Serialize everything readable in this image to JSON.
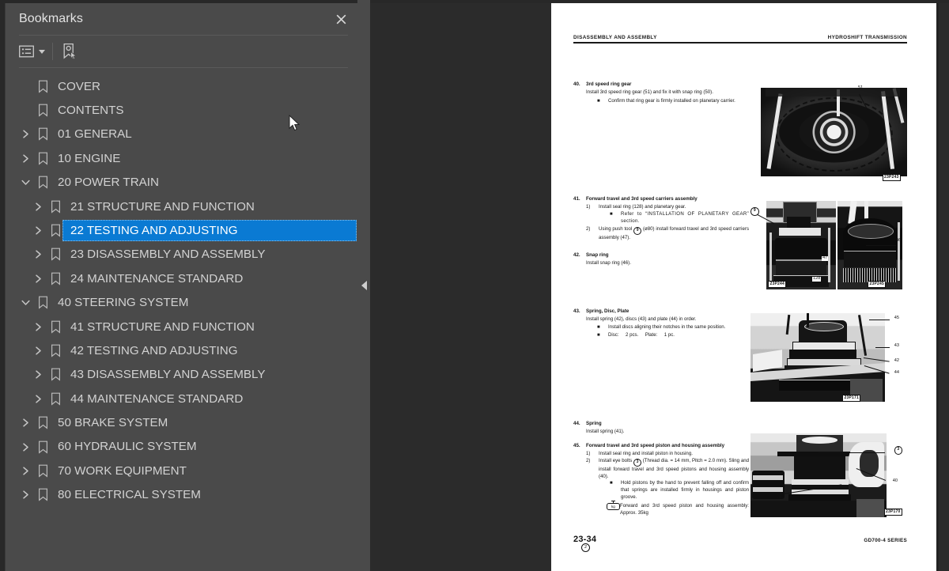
{
  "panel": {
    "title": "Bookmarks",
    "close_icon": "close-icon",
    "toolbar": {
      "options_label": "bookmark-options",
      "options_icon": "list-options-icon",
      "new_bookmark_icon": "new-bookmark-icon"
    },
    "collapse_icon": "collapse-left-icon",
    "selected_id": "22",
    "selection_color": "#0a7ad3",
    "items": [
      {
        "label": "COVER",
        "level": 0,
        "twisty": "none",
        "selected": false
      },
      {
        "label": "CONTENTS",
        "level": 0,
        "twisty": "none",
        "selected": false
      },
      {
        "label": "01 GENERAL",
        "level": 0,
        "twisty": "collapsed",
        "selected": false
      },
      {
        "label": "10 ENGINE",
        "level": 0,
        "twisty": "collapsed",
        "selected": false
      },
      {
        "label": "20 POWER TRAIN",
        "level": 0,
        "twisty": "expanded",
        "selected": false
      },
      {
        "label": "21 STRUCTURE AND FUNCTION",
        "level": 1,
        "twisty": "collapsed",
        "selected": false
      },
      {
        "label": "22 TESTING AND ADJUSTING",
        "level": 1,
        "twisty": "collapsed",
        "selected": true
      },
      {
        "label": "23 DISASSEMBLY AND ASSEMBLY",
        "level": 1,
        "twisty": "collapsed",
        "selected": false
      },
      {
        "label": "24 MAINTENANCE STANDARD",
        "level": 1,
        "twisty": "collapsed",
        "selected": false
      },
      {
        "label": "40 STEERING SYSTEM",
        "level": 0,
        "twisty": "expanded",
        "selected": false
      },
      {
        "label": "41 STRUCTURE AND FUNCTION",
        "level": 1,
        "twisty": "collapsed",
        "selected": false
      },
      {
        "label": "42 TESTING AND ADJUSTING",
        "level": 1,
        "twisty": "collapsed",
        "selected": false
      },
      {
        "label": "43 DISASSEMBLY AND ASSEMBLY",
        "level": 1,
        "twisty": "collapsed",
        "selected": false
      },
      {
        "label": "44 MAINTENANCE STANDARD",
        "level": 1,
        "twisty": "collapsed",
        "selected": false
      },
      {
        "label": "50 BRAKE SYSTEM",
        "level": 0,
        "twisty": "collapsed",
        "selected": false
      },
      {
        "label": "60 HYDRAULIC SYSTEM",
        "level": 0,
        "twisty": "collapsed",
        "selected": false
      },
      {
        "label": "70 WORK EQUIPMENT",
        "level": 0,
        "twisty": "collapsed",
        "selected": false
      },
      {
        "label": "80 ELECTRICAL SYSTEM",
        "level": 0,
        "twisty": "collapsed",
        "selected": false
      }
    ]
  },
  "document_page": {
    "header_left": "DISASSEMBLY AND ASSEMBLY",
    "header_right": "HYDROSHIFT TRANSMISSION",
    "footer_page": "23-34",
    "footer_revision": "2",
    "footer_series": "GD700-4 SERIES",
    "sections": [
      {
        "number": "40.",
        "title": "3rd speed ring gear",
        "paragraph": "Install 3rd speed ring gear (51) and fix it with snap ring (50).",
        "bullets": [
          "Confirm that ring gear is firmly installed on planetary carrier."
        ],
        "steps": []
      },
      {
        "number": "41.",
        "title": "Forward travel and 3rd speed carriers assembly",
        "paragraph": "",
        "bullets": [],
        "steps": [
          {
            "n": "1)",
            "text": "Install seal ring (128) and planetary gear.",
            "bullets": [
              "Refer to “INSTALLATION OF PLANETARY GEAR” section."
            ]
          },
          {
            "n": "2)",
            "text": "Using push tool ⓪ (ø80) install forward travel and 3rd speed carriers assembly (47).",
            "tool_circle": "9",
            "bullets": []
          }
        ]
      },
      {
        "number": "42.",
        "title": "Snap ring",
        "paragraph": "Install snap ring (46).",
        "bullets": [],
        "steps": []
      },
      {
        "number": "43.",
        "title": "Spring, Disc, Plate",
        "paragraph": "Install spring (42), discs (43) and plate (44) in order.",
        "bullets": [
          "Install discs aligning their notches in the same position.",
          "Disc:     2 pcs.     Plate:     1 pc."
        ],
        "steps": []
      },
      {
        "number": "44.",
        "title": "Spring",
        "paragraph": "Install spring (41).",
        "bullets": [],
        "steps": []
      },
      {
        "number": "45.",
        "title": "Forward travel and 3rd speed piston and housing assembly",
        "paragraph": "",
        "bullets": [],
        "steps": [
          {
            "n": "1)",
            "text": "Install seal ring and install piston in housing.",
            "bullets": []
          },
          {
            "n": "2)",
            "text": "Install eye bolts ⓪ (Thread dia. = 14 mm, Pitch = 2.0 mm). Sling and install forward travel and 3rd speed pistons and housing assembly (40).",
            "tool_circle": "3",
            "bullets": [
              "Hold pistons by the hand to prevent falling off and confirm that springs are installed firmly in housings and piston groove."
            ],
            "weight_note": "Forward and 3rd speed piston and housing assembly:   Approx. 35kg",
            "weight_unit": "kg"
          }
        ]
      }
    ],
    "figures": [
      {
        "code": "23P243",
        "callouts": [
          "51"
        ]
      },
      {
        "code": "23P244",
        "callouts": [
          "9",
          "47",
          "128"
        ]
      },
      {
        "code": "23P245",
        "callouts": [
          "46"
        ]
      },
      {
        "code": "23P171",
        "callouts": [
          "45",
          "43",
          "42",
          "44"
        ]
      },
      {
        "code": "23P170",
        "callouts": [
          "3",
          "40",
          "41"
        ]
      }
    ]
  }
}
